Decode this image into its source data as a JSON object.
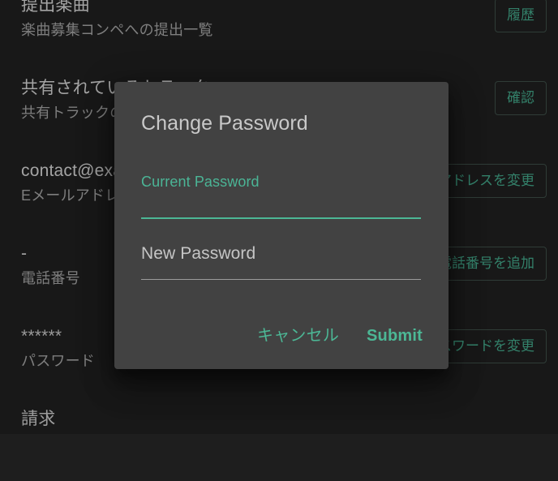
{
  "background": {
    "rows": [
      {
        "id": "submissions",
        "value": "提出楽曲",
        "label": "楽曲募集コンペへの提出一覧",
        "action": "履歴"
      },
      {
        "id": "shared",
        "value": "共有されているトラック",
        "label": "共有トラックの一覧",
        "action": "確認"
      },
      {
        "id": "email",
        "value": "contact@example.com",
        "label": "Eメールアドレス",
        "action": "メールアドレスを変更"
      },
      {
        "id": "phone",
        "value": "-",
        "label": "電話番号",
        "action": "電話番号を追加"
      },
      {
        "id": "password",
        "value": "******",
        "label": "パスワード",
        "action": "パスワードを変更"
      },
      {
        "id": "billing",
        "value": "請求",
        "label": "",
        "action": ""
      }
    ]
  },
  "dialog": {
    "title": "Change Password",
    "fields": [
      {
        "id": "current-password",
        "label": "Current Password",
        "value": "",
        "state": "focused"
      },
      {
        "id": "new-password",
        "label": "New Password",
        "value": "",
        "state": "default"
      }
    ],
    "cancel_label": "キャンセル",
    "submit_label": "Submit"
  },
  "colors": {
    "accent_green": "#4cb795",
    "dialog_background": "#424242",
    "page_background": "#1e1e1e",
    "primary_text": "#c9c9c9",
    "secondary_text": "#9a9a9a",
    "divider": "#9b9b9b"
  }
}
